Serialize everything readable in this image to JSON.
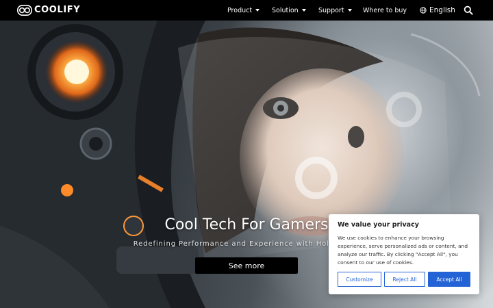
{
  "brand": {
    "name": "COOLIFY",
    "logo_icon": "infinity-logo-icon"
  },
  "nav": {
    "items": [
      {
        "label": "Product",
        "has_dropdown": true
      },
      {
        "label": "Solution",
        "has_dropdown": true
      },
      {
        "label": "Support",
        "has_dropdown": true
      },
      {
        "label": "Where to buy",
        "has_dropdown": false
      }
    ],
    "language": "English",
    "language_icon": "globe-icon",
    "search_icon": "search-icon"
  },
  "hero": {
    "title": "Cool Tech For Gamers",
    "subtitle": "Redefining Performance and Experience with Holographi",
    "cta_label": "See more"
  },
  "cookie": {
    "title": "We value your privacy",
    "text": "We use cookies to enhance your browsing experience, serve personalized ads or content, and analyze our traffic. By clicking \"Accept All\", you consent to our use of cookies.",
    "buttons": {
      "customize": "Customize",
      "reject": "Reject All",
      "accept": "Accept All"
    },
    "accent_color": "#2463d6"
  }
}
